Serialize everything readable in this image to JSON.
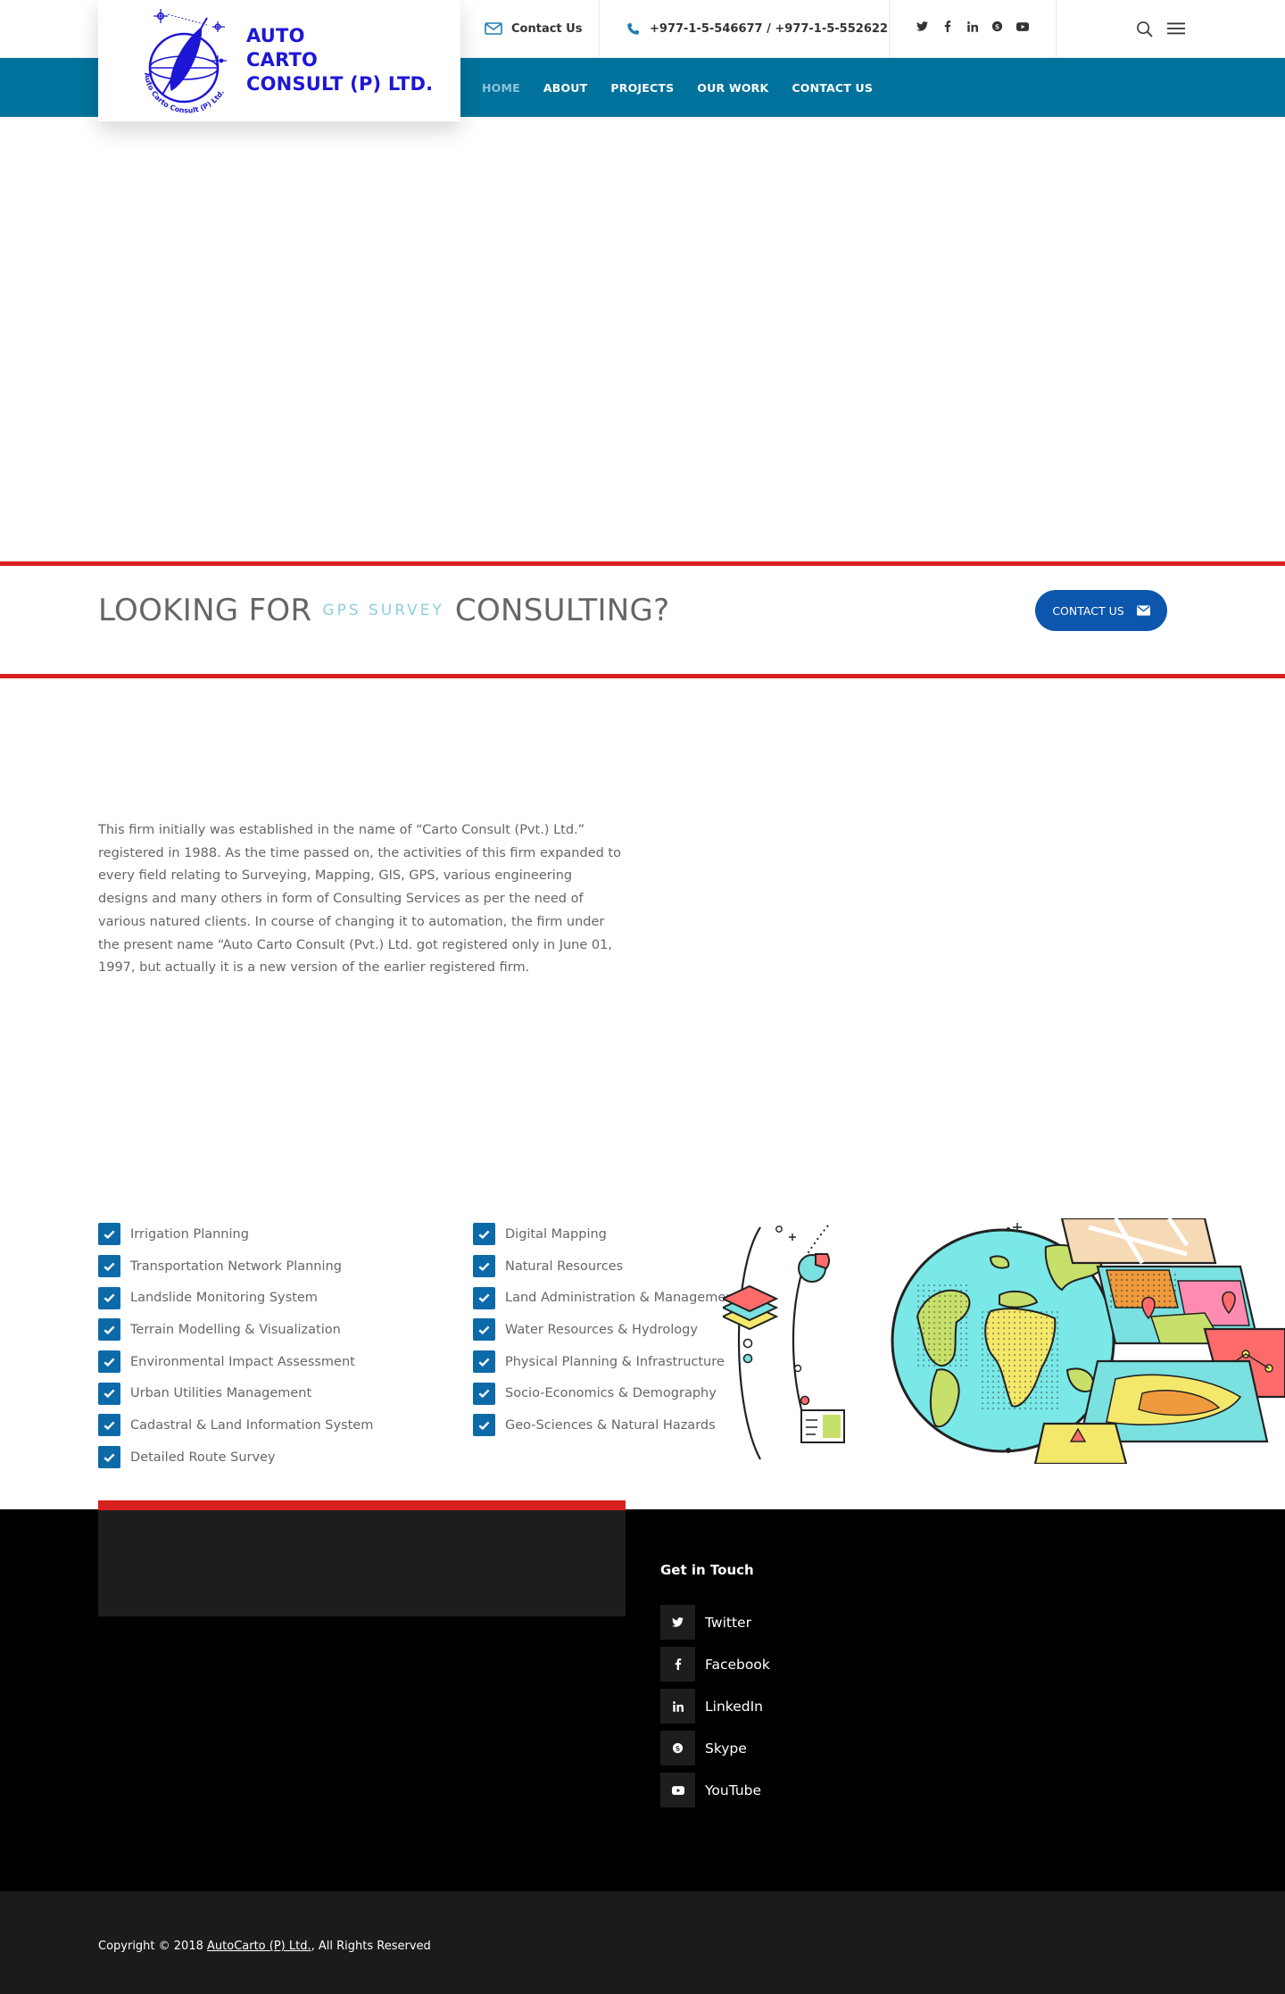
{
  "brand": {
    "line1": "AUTO",
    "line2": "CARTO",
    "line3": "CONSULT (P) LTD.",
    "seal_text": "Auto Carto Consult (P) Ltd.",
    "color": "#1d16d6"
  },
  "topbar": {
    "contact_label": "Contact Us",
    "phone": "+977-1-5-546677 / +977-1-5-552622",
    "social_icons": [
      "twitter-icon",
      "facebook-icon",
      "linkedin-icon",
      "skype-icon",
      "youtube-icon"
    ]
  },
  "nav": {
    "items": [
      "HOME",
      "ABOUT",
      "PROJECTS",
      "OUR WORK",
      "CONTACT US"
    ],
    "active": "HOME",
    "color": "#00729c"
  },
  "cta": {
    "title_start": "LOOKING FOR",
    "title_accent": "GPS SURVEY",
    "title_end": "CONSULTING?",
    "button_label": "CONTACT US",
    "button_color": "#0d56ad",
    "rule_color": "#d8201d"
  },
  "about": {
    "paragraph": "This firm initially was established in the name of “Carto Consult (Pvt.) Ltd.” registered in 1988. As the time passed on, the activities of this firm expanded to every field relating to Surveying, Mapping, GIS, GPS, various engineering designs and many others in form of Consulting Services as per the need of various natured clients. In course of changing it to automation, the firm under the present name “Auto Carto Consult (Pvt.) Ltd. got registered only in June 01, 1997, but actually it is a new version of the earlier registered firm."
  },
  "services": {
    "col1": [
      "Irrigation Planning",
      "Transportation Network Planning",
      "Landslide Monitoring System",
      "Terrain Modelling & Visualization",
      "Environmental Impact Assessment",
      "Urban Utilities Management",
      "Cadastral & Land Information System",
      "Detailed Route Survey"
    ],
    "col2": [
      "Digital Mapping",
      "Natural Resources",
      "Land Administration & Management",
      "Water Resources & Hydrology",
      "Physical Planning & Infrastructure",
      "Socio-Economics & Demography",
      "Geo-Sciences & Natural Hazards"
    ]
  },
  "footer": {
    "get_in_touch": "Get in Touch",
    "social": [
      {
        "label": "Twitter",
        "icon": "twitter-icon"
      },
      {
        "label": "Facebook",
        "icon": "facebook-icon"
      },
      {
        "label": "LinkedIn",
        "icon": "linkedin-icon"
      },
      {
        "label": "Skype",
        "icon": "skype-icon"
      },
      {
        "label": "YouTube",
        "icon": "youtube-icon"
      }
    ],
    "copyright_prefix": "Copyright © 2018",
    "copyright_link": "AutoCarto (P) Ltd.",
    "copyright_suffix": ", All Rights Reserved"
  }
}
